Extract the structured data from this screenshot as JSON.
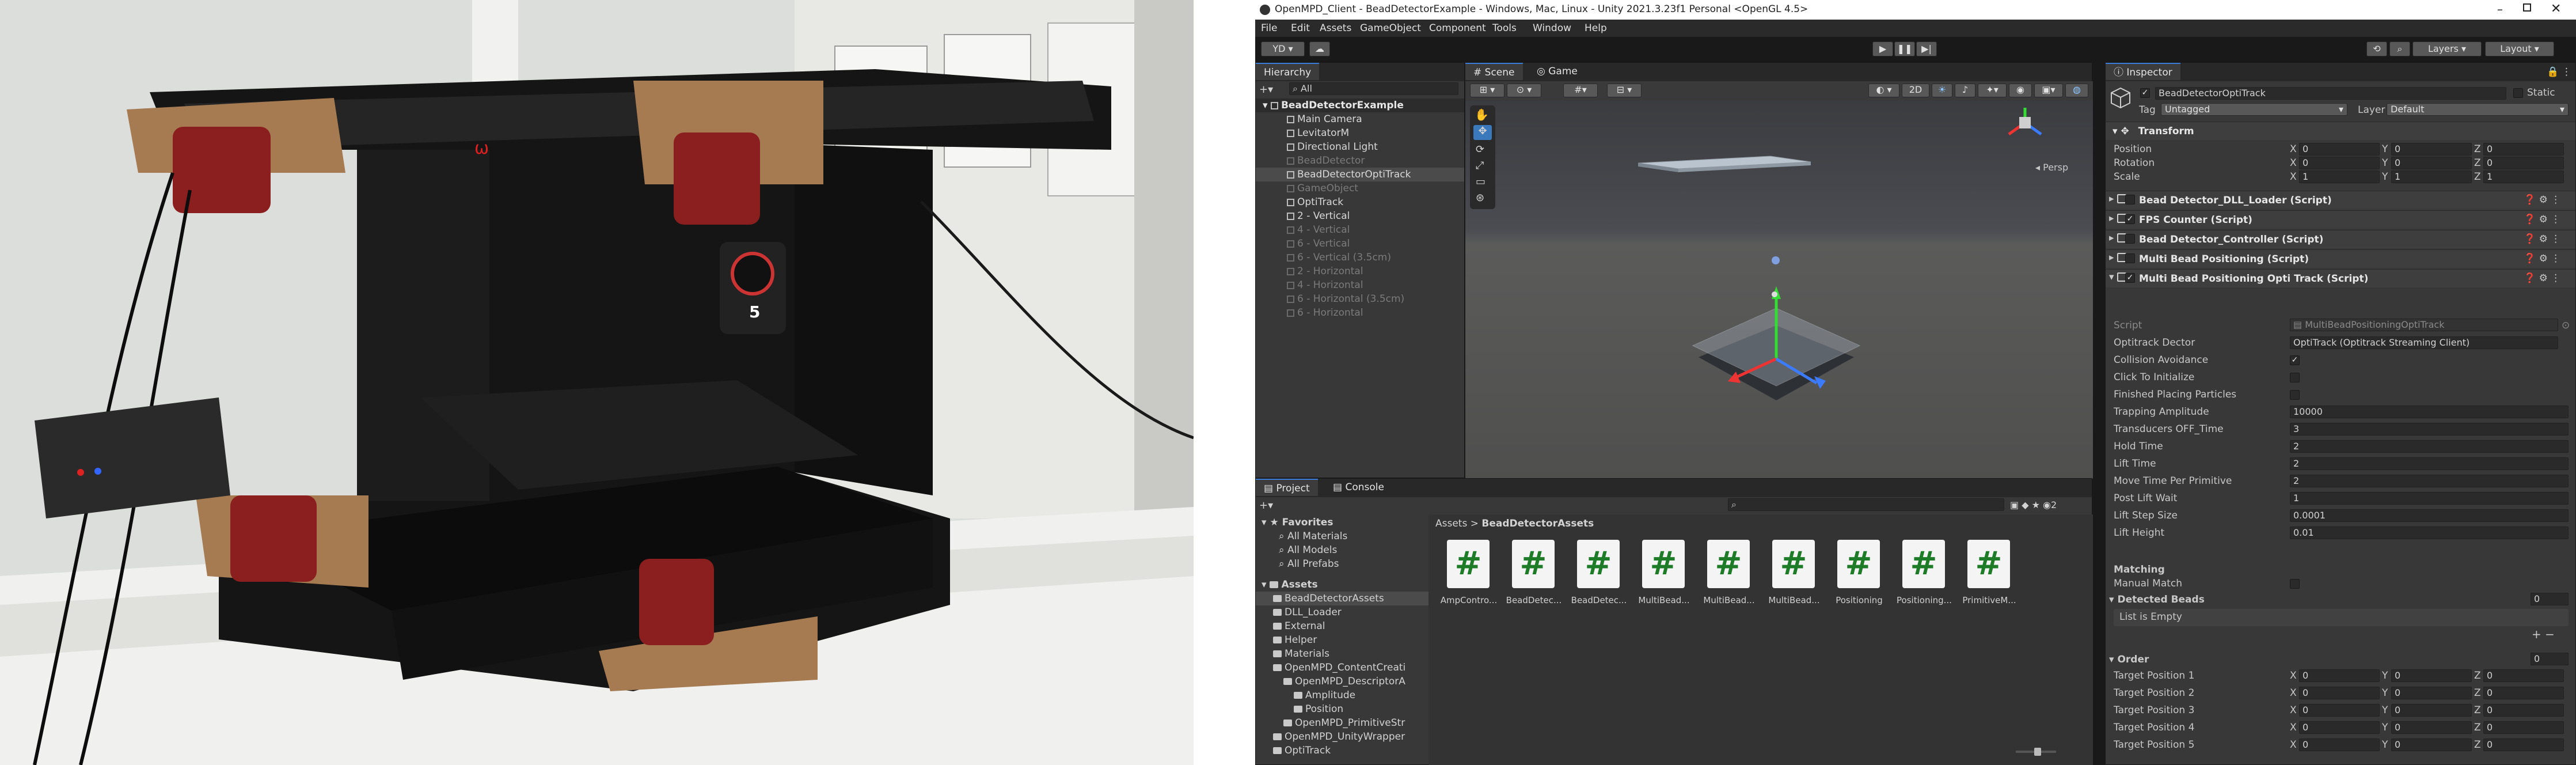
{
  "window": {
    "title": "OpenMPD_Client - BeadDetectorExample - Windows, Mac, Linux - Unity 2021.3.23f1 Personal <OpenGL 4.5>"
  },
  "menu": [
    "File",
    "Edit",
    "Assets",
    "GameObject",
    "Component",
    "Tools",
    "Window",
    "Help"
  ],
  "toolbar": {
    "account": "YD",
    "layers": "Layers",
    "layout": "Layout"
  },
  "hierarchy": {
    "tab": "Hierarchy",
    "search": "All",
    "scene": "BeadDetectorExample",
    "items": [
      {
        "label": "Main Camera",
        "active": true,
        "level": 1
      },
      {
        "label": "LevitatorM",
        "active": true,
        "level": 1
      },
      {
        "label": "Directional Light",
        "active": true,
        "level": 1
      },
      {
        "label": "BeadDetector",
        "active": false,
        "level": 1
      },
      {
        "label": "BeadDetectorOptiTrack",
        "active": true,
        "level": 1
      },
      {
        "label": "GameObject",
        "active": false,
        "level": 1
      },
      {
        "label": "OptiTrack",
        "active": true,
        "level": 1
      },
      {
        "label": "2 - Vertical",
        "active": true,
        "level": 1
      },
      {
        "label": "4 - Vertical",
        "active": false,
        "level": 1
      },
      {
        "label": "6 - Vertical",
        "active": false,
        "level": 1
      },
      {
        "label": "6 - Vertical (3.5cm)",
        "active": false,
        "level": 1
      },
      {
        "label": "2 - Horizontal",
        "active": false,
        "level": 1
      },
      {
        "label": "4 - Horizontal",
        "active": false,
        "level": 1
      },
      {
        "label": "6 - Horizontal (3.5cm)",
        "active": false,
        "level": 1
      },
      {
        "label": "6 - Horizontal",
        "active": false,
        "level": 1
      }
    ]
  },
  "scene": {
    "tab_scene": "Scene",
    "tab_game": "Game",
    "mode_2d": "2D",
    "persp": "Persp"
  },
  "project": {
    "tab_project": "Project",
    "tab_console": "Console",
    "favorites": "Favorites",
    "fav_items": [
      "All Materials",
      "All Models",
      "All Prefabs"
    ],
    "assets": "Assets",
    "tree": [
      {
        "label": "BeadDetectorAssets",
        "level": 1
      },
      {
        "label": "DLL_Loader",
        "level": 1
      },
      {
        "label": "External",
        "level": 1
      },
      {
        "label": "Helper",
        "level": 1
      },
      {
        "label": "Materials",
        "level": 1
      },
      {
        "label": "OpenMPD_ContentCreati",
        "level": 1
      },
      {
        "label": "OpenMPD_DescriptorA",
        "level": 2
      },
      {
        "label": "Amplitude",
        "level": 3
      },
      {
        "label": "Position",
        "level": 3
      },
      {
        "label": "OpenMPD_PrimitiveStr",
        "level": 2
      },
      {
        "label": "OpenMPD_UnityWrapper",
        "level": 1
      },
      {
        "label": "OptiTrack",
        "level": 1
      }
    ],
    "breadcrumb_root": "Assets",
    "breadcrumb_sep": ">",
    "breadcrumb_leaf": "BeadDetectorAssets",
    "hidden_count": "2",
    "files": [
      "AmpContro...",
      "BeadDetec...",
      "BeadDetec...",
      "MultiBead...",
      "MultiBead...",
      "MultiBead...",
      "Positioning",
      "Positioning...",
      "PrimitiveM..."
    ],
    "script_glyph": "#"
  },
  "inspector": {
    "tab": "Inspector",
    "object_name": "BeadDetectorOptiTrack",
    "static": "Static",
    "tag_label": "Tag",
    "tag_value": "Untagged",
    "layer_label": "Layer",
    "layer_value": "Default",
    "transform": {
      "title": "Transform",
      "position": {
        "label": "Position",
        "x": "0",
        "y": "0",
        "z": "0"
      },
      "rotation": {
        "label": "Rotation",
        "x": "0",
        "y": "0",
        "z": "0"
      },
      "scale": {
        "label": "Scale",
        "x": "1",
        "y": "1",
        "z": "1"
      }
    },
    "components": [
      {
        "label": "Bead Detector_DLL_Loader (Script)",
        "enabled": false
      },
      {
        "label": "FPS Counter (Script)",
        "enabled": true
      },
      {
        "label": "Bead Detector_Controller (Script)",
        "enabled": false
      },
      {
        "label": "Multi Bead Positioning (Script)",
        "enabled": false
      },
      {
        "label": "Multi Bead Positioning Opti Track (Script)",
        "enabled": true
      }
    ],
    "script_label": "Script",
    "script_value": "MultiBeadPositioningOptiTrack",
    "props": [
      {
        "label": "Optitrack Dector",
        "value": "OptiTrack (Optitrack Streaming Client)"
      },
      {
        "label": "Collision Avoidance",
        "value": "✓"
      },
      {
        "label": "Click To Initialize",
        "value": ""
      },
      {
        "label": "Finished Placing Particles",
        "value": ""
      },
      {
        "label": "Trapping Amplitude",
        "value": "10000"
      },
      {
        "label": "Transducers OFF_Time",
        "value": "3"
      },
      {
        "label": "Hold Time",
        "value": "2"
      },
      {
        "label": "Lift Time",
        "value": "2"
      },
      {
        "label": "Move Time Per Primitive",
        "value": "2"
      },
      {
        "label": "Post Lift Wait",
        "value": "1"
      },
      {
        "label": "Lift Step Size",
        "value": "0.0001"
      },
      {
        "label": "Lift Height",
        "value": "0.01"
      }
    ],
    "matching": "Matching",
    "manual_match": "Manual Match",
    "detected_beads": "Detected Beads",
    "detected_count": "0",
    "list_empty": "List is Empty",
    "order": "Order",
    "order_count": "0",
    "targets": [
      {
        "label": "Target Position 1",
        "x": "0",
        "y": "0",
        "z": "0"
      },
      {
        "label": "Target Position 2",
        "x": "0",
        "y": "0",
        "z": "0"
      },
      {
        "label": "Target Position 3",
        "x": "0",
        "y": "0",
        "z": "0"
      },
      {
        "label": "Target Position 4",
        "x": "0",
        "y": "0",
        "z": "0"
      },
      {
        "label": "Target Position 5",
        "x": "0",
        "y": "0",
        "z": "0"
      }
    ],
    "axis_x": "X",
    "axis_y": "Y",
    "axis_z": "Z"
  },
  "photo_marks": {
    "camera_label": "5",
    "led_label": "ω"
  }
}
